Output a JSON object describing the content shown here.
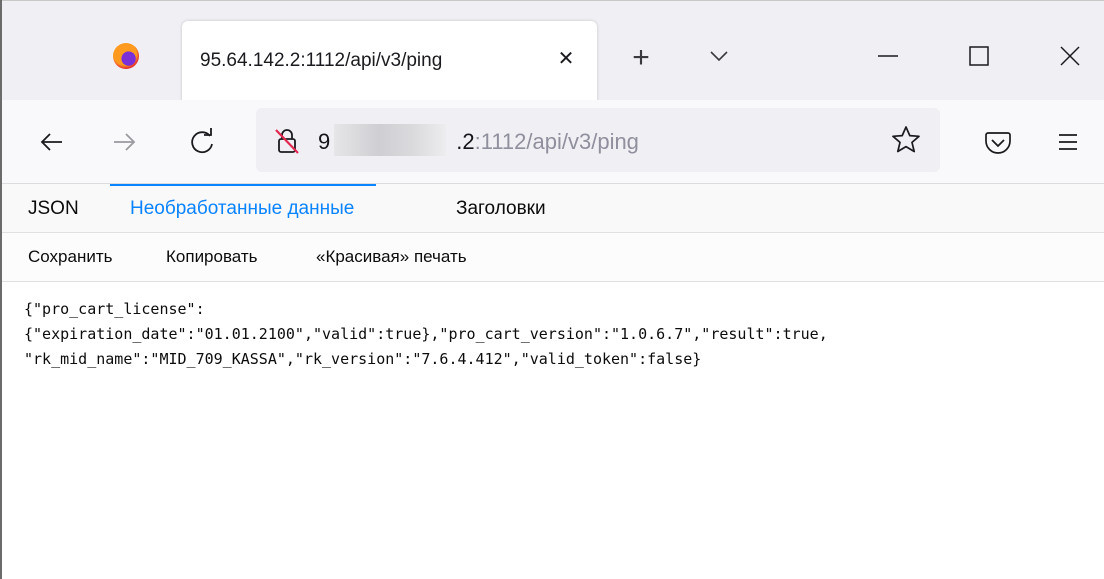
{
  "browser": {
    "tab_title": "95.64.142.2:1112/api/v3/ping",
    "new_tab_symbol": "+",
    "tab_close_symbol": "✕"
  },
  "urlbar": {
    "host_visible_prefix": "9",
    "host_visible_suffix": ".2",
    "path": ":1112/api/v3/ping"
  },
  "icons": {
    "firefox": "firefox-logo-icon",
    "tab_list": "chevron-down-icon",
    "minimize": "minimize-icon",
    "maximize": "maximize-icon",
    "close": "close-icon",
    "back": "back-arrow-icon",
    "forward": "forward-arrow-icon",
    "reload": "reload-icon",
    "insecure": "insecure-lock-icon",
    "bookmark": "star-icon",
    "pocket": "pocket-icon",
    "menu": "hamburger-menu-icon"
  },
  "viewer": {
    "tabs": [
      {
        "label": "JSON"
      },
      {
        "label": "Необработанные данные"
      },
      {
        "label": "Заголовки"
      }
    ],
    "toolbar": {
      "save": "Сохранить",
      "copy": "Копировать",
      "pretty": "«Красивая» печать"
    },
    "raw_lines": [
      "{\"pro_cart_license\":",
      "{\"expiration_date\":\"01.01.2100\",\"valid\":true},\"pro_cart_version\":\"1.0.6.7\",\"result\":true,",
      "\"rk_mid_name\":\"MID_709_KASSA\",\"rk_version\":\"7.6.4.412\",\"valid_token\":false}"
    ]
  },
  "colors": {
    "accent": "#0a84ff",
    "tabstrip_bg": "#f0f0f4",
    "toolbar_bg": "#f9f9fb",
    "text": "#0c0c0d"
  }
}
